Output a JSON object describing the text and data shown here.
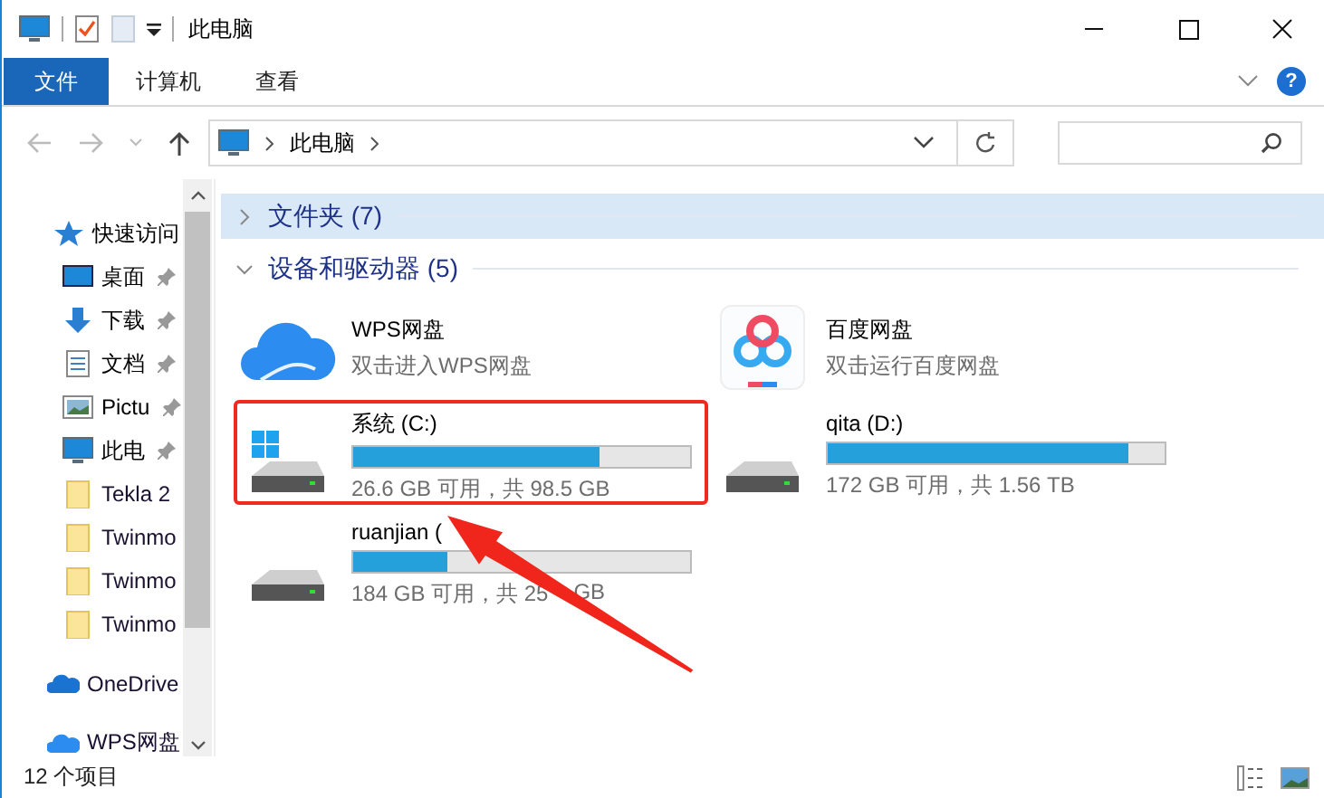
{
  "window": {
    "title": "此电脑"
  },
  "ribbon": {
    "tabs": [
      {
        "label": "文件",
        "selected": true
      },
      {
        "label": "计算机",
        "selected": false
      },
      {
        "label": "查看",
        "selected": false
      }
    ],
    "help": "?"
  },
  "address": {
    "path": [
      "此电脑"
    ]
  },
  "sidebar": {
    "items": [
      {
        "kind": "star",
        "label": "快速访问",
        "pinned": false
      },
      {
        "kind": "desktop",
        "label": "桌面",
        "pinned": true
      },
      {
        "kind": "download",
        "label": "下载",
        "pinned": true
      },
      {
        "kind": "document",
        "label": "文档",
        "pinned": true
      },
      {
        "kind": "picture",
        "label": "Pictu",
        "pinned": true
      },
      {
        "kind": "pc",
        "label": "此电",
        "pinned": true
      },
      {
        "kind": "folder",
        "label": "Tekla 2",
        "pinned": false
      },
      {
        "kind": "folder",
        "label": "Twinmo",
        "pinned": false
      },
      {
        "kind": "folder",
        "label": "Twinmo",
        "pinned": false
      },
      {
        "kind": "folder",
        "label": "Twinmo",
        "pinned": false
      },
      {
        "kind": "onedrive",
        "label": "OneDrive",
        "pinned": false
      },
      {
        "kind": "wps",
        "label": "WPS网盘",
        "pinned": false
      }
    ]
  },
  "groups": [
    {
      "title": "文件夹 (7)",
      "expanded": false,
      "selected": true
    },
    {
      "title": "设备和驱动器 (5)",
      "expanded": true,
      "selected": false
    }
  ],
  "devices": [
    {
      "kind": "wps",
      "name": "WPS网盘",
      "subtitle": "双击进入WPS网盘"
    },
    {
      "kind": "baidu",
      "name": "百度网盘",
      "subtitle": "双击运行百度网盘"
    },
    {
      "kind": "system_drive",
      "name": "系统 (C:)",
      "level": 0.73,
      "capacity": "26.6 GB 可用，共 98.5 GB"
    },
    {
      "kind": "drive",
      "name": "qita (D:)",
      "level": 0.89,
      "capacity": "172 GB 可用，共 1.56 TB"
    },
    {
      "kind": "drive",
      "name": "ruanjian (",
      "level": 0.28,
      "capacity": "184 GB 可用，共 25",
      "capacity_after": "GB"
    }
  ],
  "status_bar": {
    "count": "12 个项目"
  }
}
